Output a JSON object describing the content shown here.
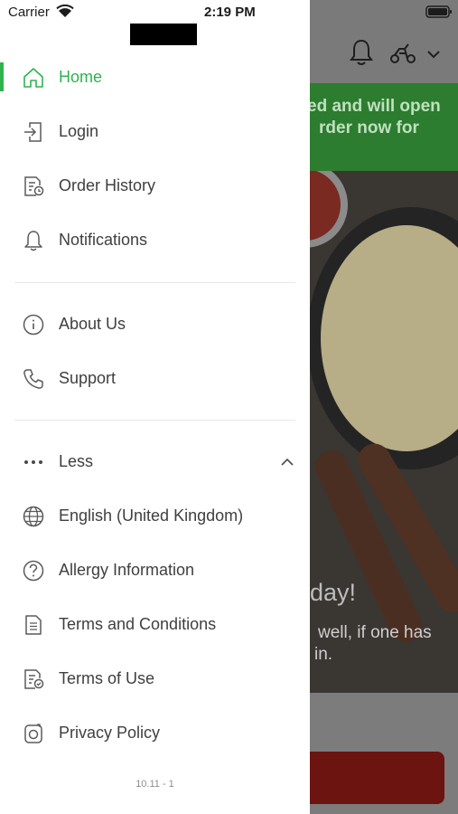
{
  "status_bar": {
    "carrier": "Carrier",
    "time": "2:19 PM"
  },
  "background_app": {
    "banner_text_line1": "ed and will open",
    "banner_text_line2": "rder now for",
    "hero_title": "day!",
    "hero_line1": "well, if one has",
    "hero_line2": "in.",
    "icons": [
      "bell-icon",
      "scooter-icon",
      "chevron-down-icon"
    ]
  },
  "drawer": {
    "accent_color": "#2eb34f",
    "items": [
      {
        "label": "Home",
        "icon": "home-icon",
        "active": true
      },
      {
        "label": "Login",
        "icon": "login-icon"
      },
      {
        "label": "Order History",
        "icon": "order-history-icon"
      },
      {
        "label": "Notifications",
        "icon": "bell-icon"
      },
      {
        "label": "About Us",
        "icon": "info-icon"
      },
      {
        "label": "Support",
        "icon": "phone-icon"
      },
      {
        "label": "Less",
        "icon": "more-dots-icon"
      },
      {
        "label": "English (United Kingdom)",
        "icon": "globe-icon"
      },
      {
        "label": "Allergy Information",
        "icon": "question-icon"
      },
      {
        "label": "Terms and Conditions",
        "icon": "document-icon"
      },
      {
        "label": "Terms of Use",
        "icon": "document-check-icon"
      },
      {
        "label": "Privacy Policy",
        "icon": "privacy-icon"
      }
    ],
    "version": "10.11 - 1"
  }
}
